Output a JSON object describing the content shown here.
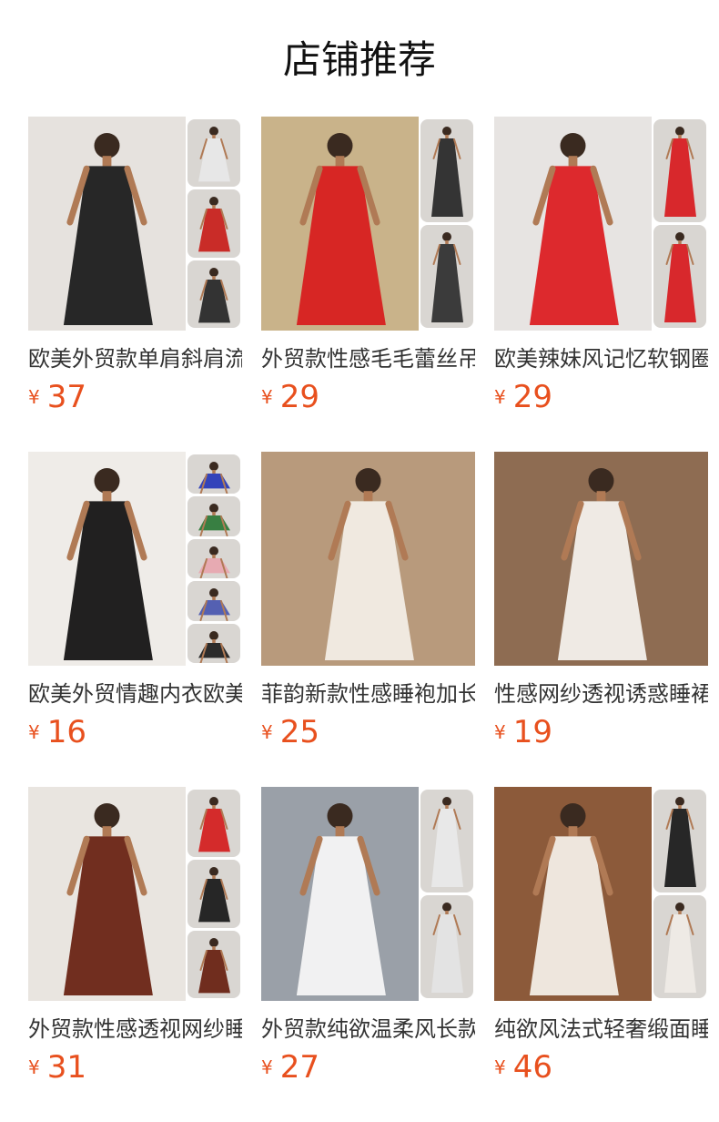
{
  "page_title": "店铺推荐",
  "currency_symbol": "¥",
  "products": [
    {
      "name": "欧美外贸款单肩斜肩流苏亮片连衣裙",
      "price": "37",
      "color": "#1c1c1c",
      "bg": "#e6e2de",
      "side_tiles": 3,
      "tile_colors": [
        "#e8e8e8",
        "#c8231f",
        "#2a2a2a"
      ]
    },
    {
      "name": "外贸款性感毛毛蕾丝吊带睡裙",
      "price": "29",
      "color": "#d81f1f",
      "bg": "#c9b38a",
      "side_tiles": 2,
      "tile_colors": [
        "#2b2b2b",
        "#333333"
      ]
    },
    {
      "name": "欧美辣妹风记忆软钢圈吊带裙",
      "price": "29",
      "color": "#dc1f23",
      "bg": "#e7e4e2",
      "side_tiles": 2,
      "tile_colors": [
        "#d81f23",
        "#d81f23"
      ]
    },
    {
      "name": "欧美外贸情趣内衣欧美吊带裙",
      "price": "16",
      "color": "#151515",
      "bg": "#efece8",
      "side_tiles": 5,
      "tile_colors": [
        "#2a3bb8",
        "#2f7a3a",
        "#e8a8b0",
        "#4d5ab0",
        "#222222"
      ]
    },
    {
      "name": "菲韵新款性感睡袍加长款",
      "price": "25",
      "color": "#f2ede6",
      "bg": "#b89a7c",
      "side_tiles": 0,
      "tile_colors": []
    },
    {
      "name": "性感网纱透视诱惑睡裙",
      "price": "19",
      "color": "#f4f1ec",
      "bg": "#8e6c52",
      "side_tiles": 0,
      "tile_colors": []
    },
    {
      "name": "外贸款性感透视网纱睡袍",
      "price": "31",
      "color": "#6a2414",
      "bg": "#e9e5e0",
      "side_tiles": 3,
      "tile_colors": [
        "#d42222",
        "#1c1c1c",
        "#6a2414"
      ]
    },
    {
      "name": "外贸款纯欲温柔风长款睡裙",
      "price": "27",
      "color": "#f6f6f6",
      "bg": "#9aa0a8",
      "side_tiles": 2,
      "tile_colors": [
        "#e9e9e9",
        "#e4e4e4"
      ]
    },
    {
      "name": "纯欲风法式轻奢缎面睡裙",
      "price": "46",
      "color": "#f3eee6",
      "bg": "#8c5a3a",
      "side_tiles": 2,
      "tile_colors": [
        "#1e1e1e",
        "#efebe6"
      ]
    }
  ]
}
